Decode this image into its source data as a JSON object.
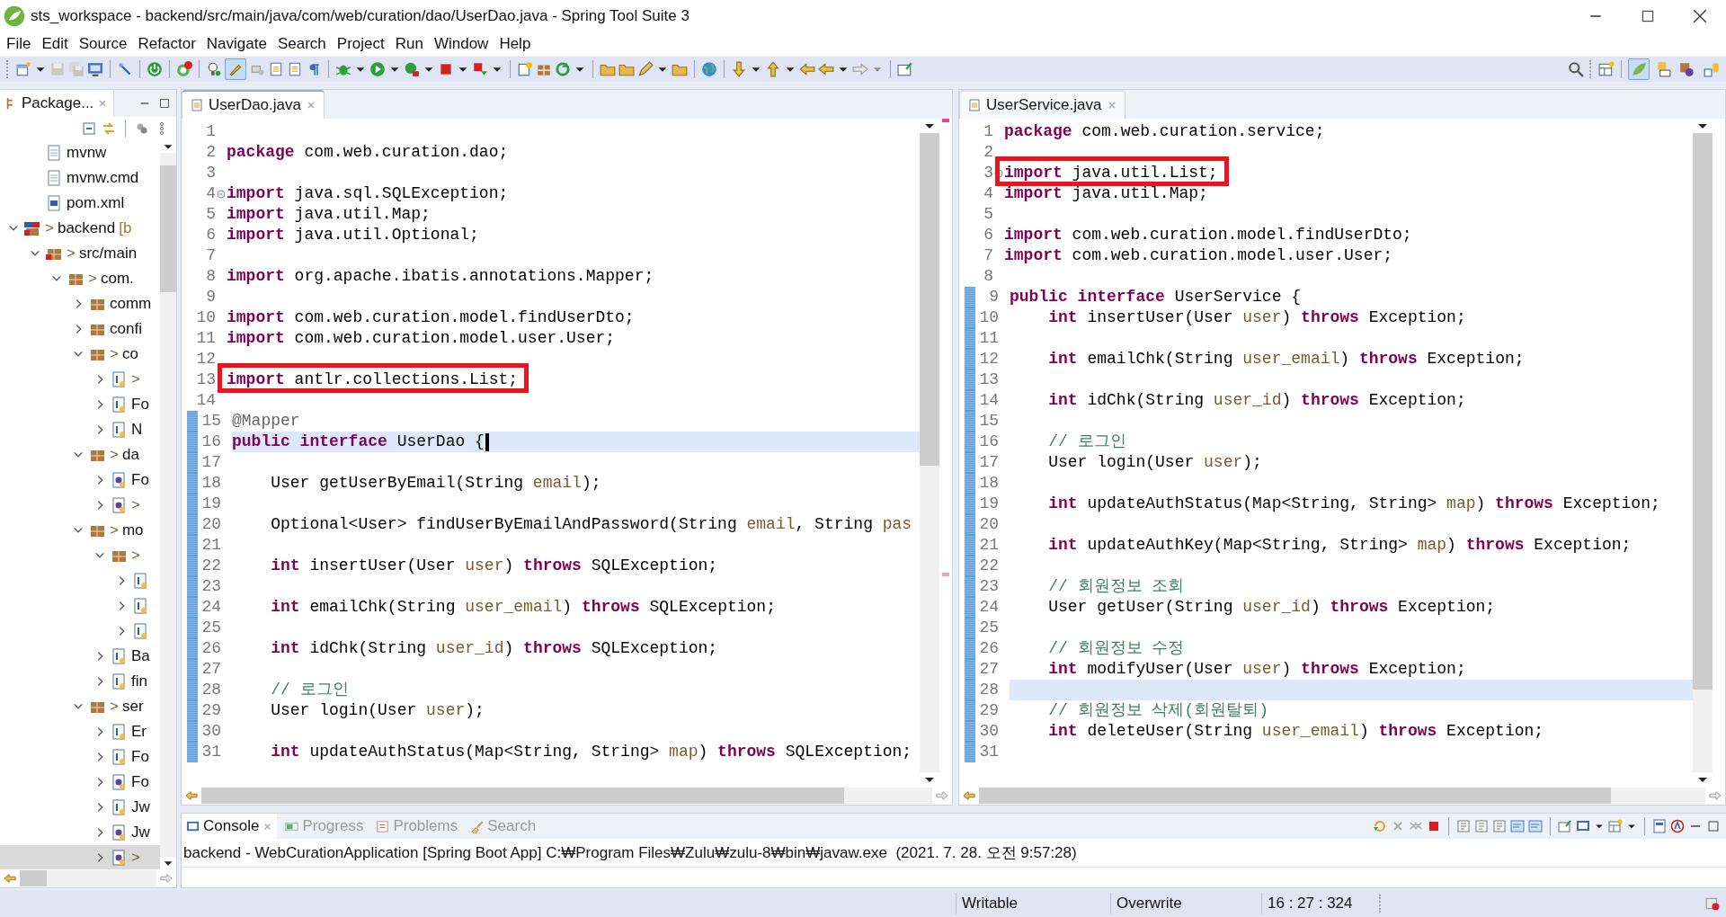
{
  "window": {
    "title": "sts_workspace - backend/src/main/java/com/web/curation/dao/UserDao.java - Spring Tool Suite 3"
  },
  "menu": [
    "File",
    "Edit",
    "Source",
    "Refactor",
    "Navigate",
    "Search",
    "Project",
    "Run",
    "Window",
    "Help"
  ],
  "toolbar": {
    "toggle_pressed": true
  },
  "perspectives": [
    {
      "selected": true
    },
    {
      "selected": false
    },
    {
      "selected": false
    },
    {
      "selected": false
    }
  ],
  "explorer": {
    "tab": "Package...",
    "partial_children": [
      {
        "label": "mvnw",
        "kind": "file"
      },
      {
        "label": "mvnw.cmd",
        "kind": "file"
      },
      {
        "label": "pom.xml",
        "kind": "xml"
      }
    ],
    "items": [
      {
        "git_mark": ">",
        "label": "backend",
        "decoration": "[b",
        "kind": "project",
        "expanded": true,
        "selected": false,
        "children": [
          {
            "git_mark": ">",
            "label": "src/main",
            "kind": "source-folder",
            "expanded": true,
            "selected": false,
            "children": [
              {
                "git_mark": ">",
                "label": "com.",
                "kind": "package",
                "expanded": true,
                "selected": false,
                "children": [
                  {
                    "label": "comm",
                    "kind": "package",
                    "expanded": false,
                    "selected": false
                  },
                  {
                    "label": "confi",
                    "kind": "package",
                    "expanded": false,
                    "selected": false
                  },
                  {
                    "git_mark": ">",
                    "label": "co",
                    "kind": "package",
                    "expanded": true,
                    "selected": false,
                    "children": [
                      {
                        "git_mark": ">",
                        "kind": "class",
                        "expanded": false,
                        "selected": false
                      },
                      {
                        "label": "Fo",
                        "kind": "class",
                        "expanded": false,
                        "selected": false
                      },
                      {
                        "label": "N",
                        "kind": "class",
                        "expanded": false,
                        "selected": false
                      }
                    ]
                  },
                  {
                    "git_mark": ">",
                    "label": "da",
                    "kind": "package",
                    "expanded": true,
                    "selected": false,
                    "children": [
                      {
                        "label": "Fo",
                        "kind": "interface",
                        "expanded": false,
                        "selected": false
                      },
                      {
                        "git_mark": ">",
                        "kind": "interface",
                        "expanded": false,
                        "selected": false
                      }
                    ]
                  },
                  {
                    "git_mark": ">",
                    "label": "mo",
                    "kind": "package",
                    "expanded": true,
                    "selected": false,
                    "children": [
                      {
                        "git_mark": ">",
                        "kind": "package",
                        "expanded": true,
                        "selected": false,
                        "children": [
                          {
                            "kind": "class",
                            "expanded": false,
                            "selected": false
                          },
                          {
                            "kind": "class",
                            "expanded": false,
                            "selected": false
                          },
                          {
                            "kind": "class",
                            "expanded": false,
                            "selected": false
                          }
                        ]
                      },
                      {
                        "label": "Ba",
                        "kind": "class",
                        "expanded": false,
                        "selected": false
                      },
                      {
                        "label": "fin",
                        "kind": "class",
                        "expanded": false,
                        "selected": false
                      }
                    ]
                  },
                  {
                    "git_mark": ">",
                    "label": "ser",
                    "kind": "package",
                    "expanded": true,
                    "selected": false,
                    "children": [
                      {
                        "label": "Er",
                        "kind": "class",
                        "expanded": false,
                        "selected": false
                      },
                      {
                        "label": "Fo",
                        "kind": "class",
                        "expanded": false,
                        "selected": false
                      },
                      {
                        "label": "Fo",
                        "kind": "interface",
                        "expanded": false,
                        "selected": false
                      },
                      {
                        "label": "Jw",
                        "kind": "class",
                        "expanded": false,
                        "selected": false
                      },
                      {
                        "label": "Jw",
                        "kind": "interface",
                        "expanded": false,
                        "selected": false
                      },
                      {
                        "git_mark": ">",
                        "kind": "interface",
                        "expanded": false,
                        "selected": true
                      }
                    ]
                  }
                ]
              }
            ]
          }
        ]
      }
    ]
  },
  "editors": [
    {
      "tab": "UserDao.java",
      "selected": true,
      "has_cursor": true,
      "lines": [
        {
          "n": "1",
          "changed": false,
          "current": false,
          "boxed": false,
          "fold": false
        },
        {
          "n": "2",
          "s": [
            {
              "kind": "keyword",
              "text": "package"
            },
            {
              "kind": "plain",
              "text": " com.web.curation.dao;"
            }
          ],
          "changed": false,
          "current": false,
          "boxed": false,
          "fold": false
        },
        {
          "n": "3",
          "changed": false,
          "current": false,
          "boxed": false,
          "fold": false
        },
        {
          "n": "4",
          "s": [
            {
              "kind": "keyword",
              "text": "import"
            },
            {
              "kind": "plain",
              "text": " java.sql.SQLException;"
            }
          ],
          "changed": false,
          "current": false,
          "boxed": false,
          "fold": true
        },
        {
          "n": "5",
          "s": [
            {
              "kind": "keyword",
              "text": "import"
            },
            {
              "kind": "plain",
              "text": " java.util.Map;"
            }
          ],
          "changed": false,
          "current": false,
          "boxed": false,
          "fold": false
        },
        {
          "n": "6",
          "s": [
            {
              "kind": "keyword",
              "text": "import"
            },
            {
              "kind": "plain",
              "text": " java.util.Optional;"
            }
          ],
          "changed": false,
          "current": false,
          "boxed": false,
          "fold": false
        },
        {
          "n": "7",
          "changed": false,
          "current": false,
          "boxed": false,
          "fold": false
        },
        {
          "n": "8",
          "s": [
            {
              "kind": "keyword",
              "text": "import"
            },
            {
              "kind": "plain",
              "text": " org.apache.ibatis.annotations.Mapper;"
            }
          ],
          "changed": false,
          "current": false,
          "boxed": false,
          "fold": false
        },
        {
          "n": "9",
          "changed": false,
          "current": false,
          "boxed": false,
          "fold": false
        },
        {
          "n": "10",
          "s": [
            {
              "kind": "keyword",
              "text": "import"
            },
            {
              "kind": "plain",
              "text": " com.web.curation.model.findUserDto;"
            }
          ],
          "changed": false,
          "current": false,
          "boxed": false,
          "fold": false
        },
        {
          "n": "11",
          "s": [
            {
              "kind": "keyword",
              "text": "import"
            },
            {
              "kind": "plain",
              "text": " com.web.curation.model.user.User;"
            }
          ],
          "changed": false,
          "current": false,
          "boxed": false,
          "fold": false
        },
        {
          "n": "12",
          "changed": false,
          "current": false,
          "boxed": false,
          "fold": false
        },
        {
          "n": "13",
          "s": [
            {
              "kind": "keyword",
              "text": "import"
            },
            {
              "kind": "plain",
              "text": " antlr.collections.List;"
            }
          ],
          "changed": false,
          "current": false,
          "boxed": true,
          "fold": false
        },
        {
          "n": "14",
          "changed": false,
          "current": false,
          "boxed": false,
          "fold": false
        },
        {
          "n": "15",
          "s": [
            {
              "kind": "annotation",
              "text": "@Mapper"
            }
          ],
          "changed": true,
          "current": false,
          "boxed": false,
          "fold": false
        },
        {
          "n": "16",
          "s": [
            {
              "kind": "keyword",
              "text": "public interface"
            },
            {
              "kind": "plain",
              "text": " UserDao {"
            }
          ],
          "changed": true,
          "current": true,
          "boxed": false,
          "fold": false
        },
        {
          "n": "17",
          "changed": true,
          "current": false,
          "boxed": false,
          "fold": false
        },
        {
          "n": "18",
          "s": [
            {
              "kind": "plain",
              "text": "    User getUserByEmail(String "
            },
            {
              "kind": "param",
              "text": "email"
            },
            {
              "kind": "plain",
              "text": ");"
            }
          ],
          "changed": true,
          "current": false,
          "boxed": false,
          "fold": false
        },
        {
          "n": "19",
          "changed": true,
          "current": false,
          "boxed": false,
          "fold": false
        },
        {
          "n": "20",
          "s": [
            {
              "kind": "plain",
              "text": "    Optional<User> findUserByEmailAndPassword(String "
            },
            {
              "kind": "param",
              "text": "email"
            },
            {
              "kind": "plain",
              "text": ", String "
            },
            {
              "kind": "param",
              "text": "pas"
            }
          ],
          "changed": true,
          "current": false,
          "boxed": false,
          "fold": false
        },
        {
          "n": "21",
          "changed": true,
          "current": false,
          "boxed": false,
          "fold": false
        },
        {
          "n": "22",
          "s": [
            {
              "kind": "keyword",
              "text": "    int"
            },
            {
              "kind": "plain",
              "text": " insertUser(User "
            },
            {
              "kind": "param",
              "text": "user"
            },
            {
              "kind": "plain",
              "text": ") "
            },
            {
              "kind": "keyword",
              "text": "throws"
            },
            {
              "kind": "plain",
              "text": " SQLException;"
            }
          ],
          "changed": true,
          "current": false,
          "boxed": false,
          "fold": false
        },
        {
          "n": "23",
          "changed": true,
          "current": false,
          "boxed": false,
          "fold": false
        },
        {
          "n": "24",
          "s": [
            {
              "kind": "keyword",
              "text": "    int"
            },
            {
              "kind": "plain",
              "text": " emailChk(String "
            },
            {
              "kind": "param",
              "text": "user_email"
            },
            {
              "kind": "plain",
              "text": ") "
            },
            {
              "kind": "keyword",
              "text": "throws"
            },
            {
              "kind": "plain",
              "text": " SQLException;"
            }
          ],
          "changed": true,
          "current": false,
          "boxed": false,
          "fold": false
        },
        {
          "n": "25",
          "changed": true,
          "current": false,
          "boxed": false,
          "fold": false
        },
        {
          "n": "26",
          "s": [
            {
              "kind": "keyword",
              "text": "    int"
            },
            {
              "kind": "plain",
              "text": " idChk(String "
            },
            {
              "kind": "param",
              "text": "user_id"
            },
            {
              "kind": "plain",
              "text": ") "
            },
            {
              "kind": "keyword",
              "text": "throws"
            },
            {
              "kind": "plain",
              "text": " SQLException;"
            }
          ],
          "changed": true,
          "current": false,
          "boxed": false,
          "fold": false
        },
        {
          "n": "27",
          "changed": true,
          "current": false,
          "boxed": false,
          "fold": false
        },
        {
          "n": "28",
          "s": [
            {
              "kind": "comment",
              "text": "    // 로그인"
            }
          ],
          "changed": true,
          "current": false,
          "boxed": false,
          "fold": false
        },
        {
          "n": "29",
          "s": [
            {
              "kind": "plain",
              "text": "    User login(User "
            },
            {
              "kind": "param",
              "text": "user"
            },
            {
              "kind": "plain",
              "text": ");"
            }
          ],
          "changed": true,
          "current": false,
          "boxed": false,
          "fold": false
        },
        {
          "n": "30",
          "changed": true,
          "current": false,
          "boxed": false,
          "fold": false
        },
        {
          "n": "31",
          "s": [
            {
              "kind": "keyword",
              "text": "    int"
            },
            {
              "kind": "plain",
              "text": " updateAuthStatus(Map<String, String> "
            },
            {
              "kind": "param",
              "text": "map"
            },
            {
              "kind": "plain",
              "text": ") "
            },
            {
              "kind": "keyword",
              "text": "throws"
            },
            {
              "kind": "plain",
              "text": " SQLException;"
            }
          ],
          "changed": true,
          "current": false,
          "boxed": false,
          "fold": false
        }
      ]
    },
    {
      "tab": "UserService.java",
      "selected": false,
      "has_cursor": false,
      "lines": [
        {
          "n": "1",
          "s": [
            {
              "kind": "keyword",
              "text": "package"
            },
            {
              "kind": "plain",
              "text": " com.web.curation.service;"
            }
          ],
          "changed": false,
          "current": false,
          "boxed": false,
          "fold": false
        },
        {
          "n": "2",
          "changed": false,
          "current": false,
          "boxed": false,
          "fold": false
        },
        {
          "n": "3",
          "s": [
            {
              "kind": "keyword",
              "text": "import"
            },
            {
              "kind": "plain",
              "text": " java.util.List;"
            }
          ],
          "changed": false,
          "current": false,
          "boxed": true,
          "fold": true
        },
        {
          "n": "4",
          "s": [
            {
              "kind": "keyword",
              "text": "import"
            },
            {
              "kind": "plain",
              "text": " java.util.Map;"
            }
          ],
          "changed": false,
          "current": false,
          "boxed": false,
          "fold": false
        },
        {
          "n": "5",
          "changed": false,
          "current": false,
          "boxed": false,
          "fold": false
        },
        {
          "n": "6",
          "s": [
            {
              "kind": "keyword",
              "text": "import"
            },
            {
              "kind": "plain",
              "text": " com.web.curation.model.findUserDto;"
            }
          ],
          "changed": false,
          "current": false,
          "boxed": false,
          "fold": false
        },
        {
          "n": "7",
          "s": [
            {
              "kind": "keyword",
              "text": "import"
            },
            {
              "kind": "plain",
              "text": " com.web.curation.model.user.User;"
            }
          ],
          "changed": false,
          "current": false,
          "boxed": false,
          "fold": false
        },
        {
          "n": "8",
          "changed": false,
          "current": false,
          "boxed": false,
          "fold": false
        },
        {
          "n": "9",
          "s": [
            {
              "kind": "keyword",
              "text": "public interface"
            },
            {
              "kind": "plain",
              "text": " UserService {"
            }
          ],
          "changed": true,
          "current": false,
          "boxed": false,
          "fold": false
        },
        {
          "n": "10",
          "s": [
            {
              "kind": "keyword",
              "text": "    int"
            },
            {
              "kind": "plain",
              "text": " insertUser(User "
            },
            {
              "kind": "param",
              "text": "user"
            },
            {
              "kind": "plain",
              "text": ") "
            },
            {
              "kind": "keyword",
              "text": "throws"
            },
            {
              "kind": "plain",
              "text": " Exception;"
            }
          ],
          "changed": true,
          "current": false,
          "boxed": false,
          "fold": false
        },
        {
          "n": "11",
          "changed": true,
          "current": false,
          "boxed": false,
          "fold": false
        },
        {
          "n": "12",
          "s": [
            {
              "kind": "keyword",
              "text": "    int"
            },
            {
              "kind": "plain",
              "text": " emailChk(String "
            },
            {
              "kind": "param",
              "text": "user_email"
            },
            {
              "kind": "plain",
              "text": ") "
            },
            {
              "kind": "keyword",
              "text": "throws"
            },
            {
              "kind": "plain",
              "text": " Exception;"
            }
          ],
          "changed": true,
          "current": false,
          "boxed": false,
          "fold": false
        },
        {
          "n": "13",
          "changed": true,
          "current": false,
          "boxed": false,
          "fold": false
        },
        {
          "n": "14",
          "s": [
            {
              "kind": "keyword",
              "text": "    int"
            },
            {
              "kind": "plain",
              "text": " idChk(String "
            },
            {
              "kind": "param",
              "text": "user_id"
            },
            {
              "kind": "plain",
              "text": ") "
            },
            {
              "kind": "keyword",
              "text": "throws"
            },
            {
              "kind": "plain",
              "text": " Exception;"
            }
          ],
          "changed": true,
          "current": false,
          "boxed": false,
          "fold": false
        },
        {
          "n": "15",
          "changed": true,
          "current": false,
          "boxed": false,
          "fold": false
        },
        {
          "n": "16",
          "s": [
            {
              "kind": "comment",
              "text": "    // 로그인"
            }
          ],
          "changed": true,
          "current": false,
          "boxed": false,
          "fold": false
        },
        {
          "n": "17",
          "s": [
            {
              "kind": "plain",
              "text": "    User login(User "
            },
            {
              "kind": "param",
              "text": "user"
            },
            {
              "kind": "plain",
              "text": ");"
            }
          ],
          "changed": true,
          "current": false,
          "boxed": false,
          "fold": false
        },
        {
          "n": "18",
          "changed": true,
          "current": false,
          "boxed": false,
          "fold": false
        },
        {
          "n": "19",
          "s": [
            {
              "kind": "keyword",
              "text": "    int"
            },
            {
              "kind": "plain",
              "text": " updateAuthStatus(Map<String, String> "
            },
            {
              "kind": "param",
              "text": "map"
            },
            {
              "kind": "plain",
              "text": ") "
            },
            {
              "kind": "keyword",
              "text": "throws"
            },
            {
              "kind": "plain",
              "text": " Exception;"
            }
          ],
          "changed": true,
          "current": false,
          "boxed": false,
          "fold": false
        },
        {
          "n": "20",
          "changed": true,
          "current": false,
          "boxed": false,
          "fold": false
        },
        {
          "n": "21",
          "s": [
            {
              "kind": "keyword",
              "text": "    int"
            },
            {
              "kind": "plain",
              "text": " updateAuthKey(Map<String, String> "
            },
            {
              "kind": "param",
              "text": "map"
            },
            {
              "kind": "plain",
              "text": ") "
            },
            {
              "kind": "keyword",
              "text": "throws"
            },
            {
              "kind": "plain",
              "text": " Exception;"
            }
          ],
          "changed": true,
          "current": false,
          "boxed": false,
          "fold": false
        },
        {
          "n": "22",
          "changed": true,
          "current": false,
          "boxed": false,
          "fold": false
        },
        {
          "n": "23",
          "s": [
            {
              "kind": "comment",
              "text": "    // 회원정보 조회"
            }
          ],
          "changed": true,
          "current": false,
          "boxed": false,
          "fold": false
        },
        {
          "n": "24",
          "s": [
            {
              "kind": "plain",
              "text": "    User getUser(String "
            },
            {
              "kind": "param",
              "text": "user_id"
            },
            {
              "kind": "plain",
              "text": ") "
            },
            {
              "kind": "keyword",
              "text": "throws"
            },
            {
              "kind": "plain",
              "text": " Exception;"
            }
          ],
          "changed": true,
          "current": false,
          "boxed": false,
          "fold": false
        },
        {
          "n": "25",
          "changed": true,
          "current": false,
          "boxed": false,
          "fold": false
        },
        {
          "n": "26",
          "s": [
            {
              "kind": "comment",
              "text": "    // 회원정보 수정"
            }
          ],
          "changed": true,
          "current": false,
          "boxed": false,
          "fold": false
        },
        {
          "n": "27",
          "s": [
            {
              "kind": "keyword",
              "text": "    int"
            },
            {
              "kind": "plain",
              "text": " modifyUser(User "
            },
            {
              "kind": "param",
              "text": "user"
            },
            {
              "kind": "plain",
              "text": ") "
            },
            {
              "kind": "keyword",
              "text": "throws"
            },
            {
              "kind": "plain",
              "text": " Exception;"
            }
          ],
          "changed": true,
          "current": false,
          "boxed": false,
          "fold": false
        },
        {
          "n": "28",
          "changed": true,
          "current": true,
          "boxed": false,
          "fold": false
        },
        {
          "n": "29",
          "s": [
            {
              "kind": "comment",
              "text": "    // 회원정보 삭제(회원탈퇴)"
            }
          ],
          "changed": true,
          "current": false,
          "boxed": false,
          "fold": false
        },
        {
          "n": "30",
          "s": [
            {
              "kind": "keyword",
              "text": "    int"
            },
            {
              "kind": "plain",
              "text": " deleteUser(String "
            },
            {
              "kind": "param",
              "text": "user_email"
            },
            {
              "kind": "plain",
              "text": ") "
            },
            {
              "kind": "keyword",
              "text": "throws"
            },
            {
              "kind": "plain",
              "text": " Exception;"
            }
          ],
          "changed": true,
          "current": false,
          "boxed": false,
          "fold": false
        },
        {
          "n": "31",
          "changed": true,
          "current": false,
          "boxed": false,
          "fold": false
        }
      ]
    }
  ],
  "console": {
    "tabs": [
      {
        "label": "Console",
        "kind": "console",
        "selected": true
      },
      {
        "label": "Progress",
        "kind": "progress",
        "selected": false
      },
      {
        "label": "Problems",
        "kind": "problems",
        "selected": false
      },
      {
        "label": "Search",
        "kind": "search",
        "selected": false
      }
    ],
    "text": "backend - WebCurationApplication [Spring Boot App] C:₩Program Files₩Zulu₩zulu-8₩bin₩javaw.exe  (2021. 7. 28. 오전 9:57:28)"
  },
  "status_bar": [
    "Writable",
    "Overwrite",
    "16 : 27 : 324"
  ]
}
